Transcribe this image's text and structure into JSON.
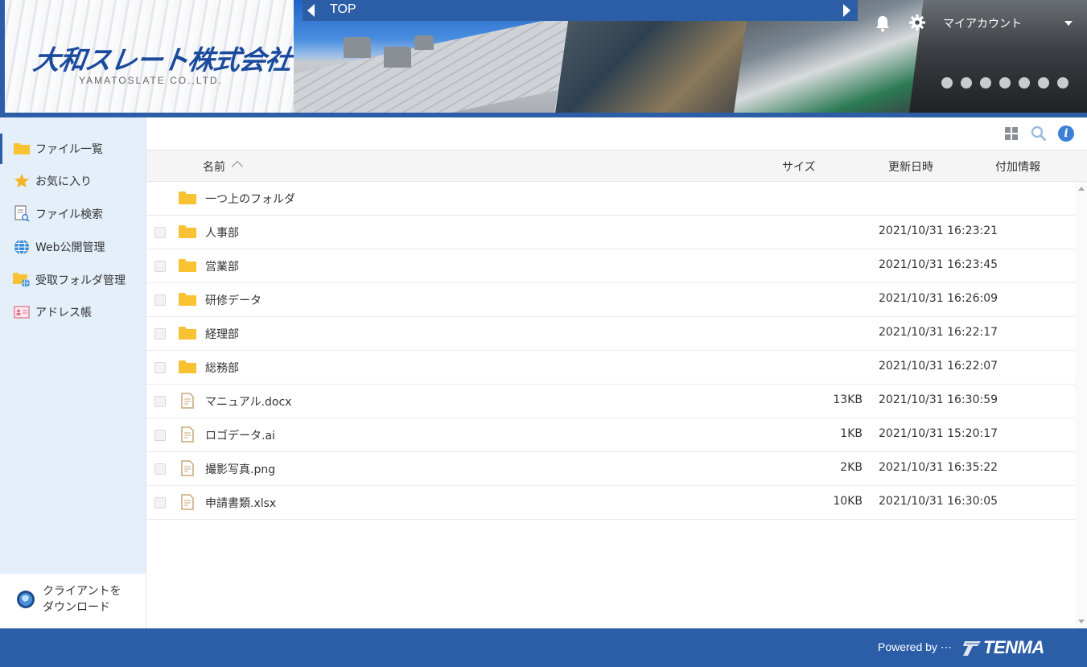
{
  "header": {
    "logo_jp": "大和スレート株式会社",
    "logo_en": "YAMATOSLATE CO.,LTD.",
    "breadcrumb_title": "TOP",
    "account_label": "マイアカウント"
  },
  "sidebar": {
    "items": [
      {
        "label": "ファイル一覧",
        "icon": "folder-icon"
      },
      {
        "label": "お気に入り",
        "icon": "star-icon"
      },
      {
        "label": "ファイル検索",
        "icon": "file-search-icon"
      },
      {
        "label": "Web公開管理",
        "icon": "globe-icon"
      },
      {
        "label": "受取フォルダ管理",
        "icon": "receive-folder-icon"
      },
      {
        "label": "アドレス帳",
        "icon": "address-book-icon"
      }
    ],
    "download_line1": "クライアントを",
    "download_line2": "ダウンロード"
  },
  "table": {
    "columns": {
      "name": "名前",
      "size": "サイズ",
      "updated": "更新日時",
      "extra": "付加情報"
    },
    "parent_folder": "一つ上のフォルダ",
    "rows": [
      {
        "name": "人事部",
        "type": "folder",
        "size": "",
        "updated": "2021/10/31 16:23:21"
      },
      {
        "name": "営業部",
        "type": "folder",
        "size": "",
        "updated": "2021/10/31 16:23:45"
      },
      {
        "name": "研修データ",
        "type": "folder",
        "size": "",
        "updated": "2021/10/31 16:26:09"
      },
      {
        "name": "経理部",
        "type": "folder",
        "size": "",
        "updated": "2021/10/31 16:22:17"
      },
      {
        "name": "総務部",
        "type": "folder",
        "size": "",
        "updated": "2021/10/31 16:22:07"
      },
      {
        "name": "マニュアル.docx",
        "type": "file",
        "size": "13KB",
        "updated": "2021/10/31 16:30:59"
      },
      {
        "name": "ロゴデータ.ai",
        "type": "file",
        "size": "1KB",
        "updated": "2021/10/31 15:20:17"
      },
      {
        "name": "撮影写真.png",
        "type": "file",
        "size": "2KB",
        "updated": "2021/10/31 16:35:22"
      },
      {
        "name": "申請書類.xlsx",
        "type": "file",
        "size": "10KB",
        "updated": "2021/10/31 16:30:05"
      }
    ]
  },
  "footer": {
    "powered_by": "Powered by ⋯",
    "brand": "TENMA"
  },
  "colors": {
    "primary_blue": "#2c5ea8",
    "sidebar_bg": "#e4effa",
    "folder_yellow": "#f8c233",
    "file_icon": "#c9a77a",
    "info_blue": "#3b7fd6"
  }
}
